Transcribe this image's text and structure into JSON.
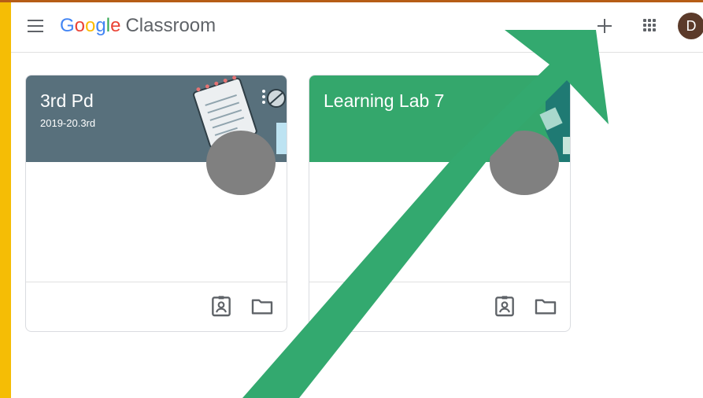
{
  "app": {
    "logo_letters": [
      "G",
      "o",
      "o",
      "g",
      "l",
      "e"
    ],
    "product_name": "Classroom"
  },
  "header": {
    "avatar_initial": "D"
  },
  "classes": [
    {
      "title": "3rd Pd",
      "section": "2019-20.3rd",
      "header_color": "#58707c"
    },
    {
      "title": "Learning Lab 7",
      "section": "",
      "header_color": "#34a76c"
    }
  ],
  "icons": {
    "menu": "hamburger-icon",
    "create": "plus-icon",
    "apps": "apps-grid-icon",
    "assignments": "assignment-portrait-icon",
    "drive_folder": "folder-icon",
    "more": "more-vert-icon"
  },
  "colors": {
    "google_blue": "#4285f4",
    "google_red": "#ea4335",
    "google_yellow": "#fbbc05",
    "google_green": "#34a853",
    "overlay_arrow": "#33a96f",
    "frame_yellow": "#f5bd05"
  }
}
